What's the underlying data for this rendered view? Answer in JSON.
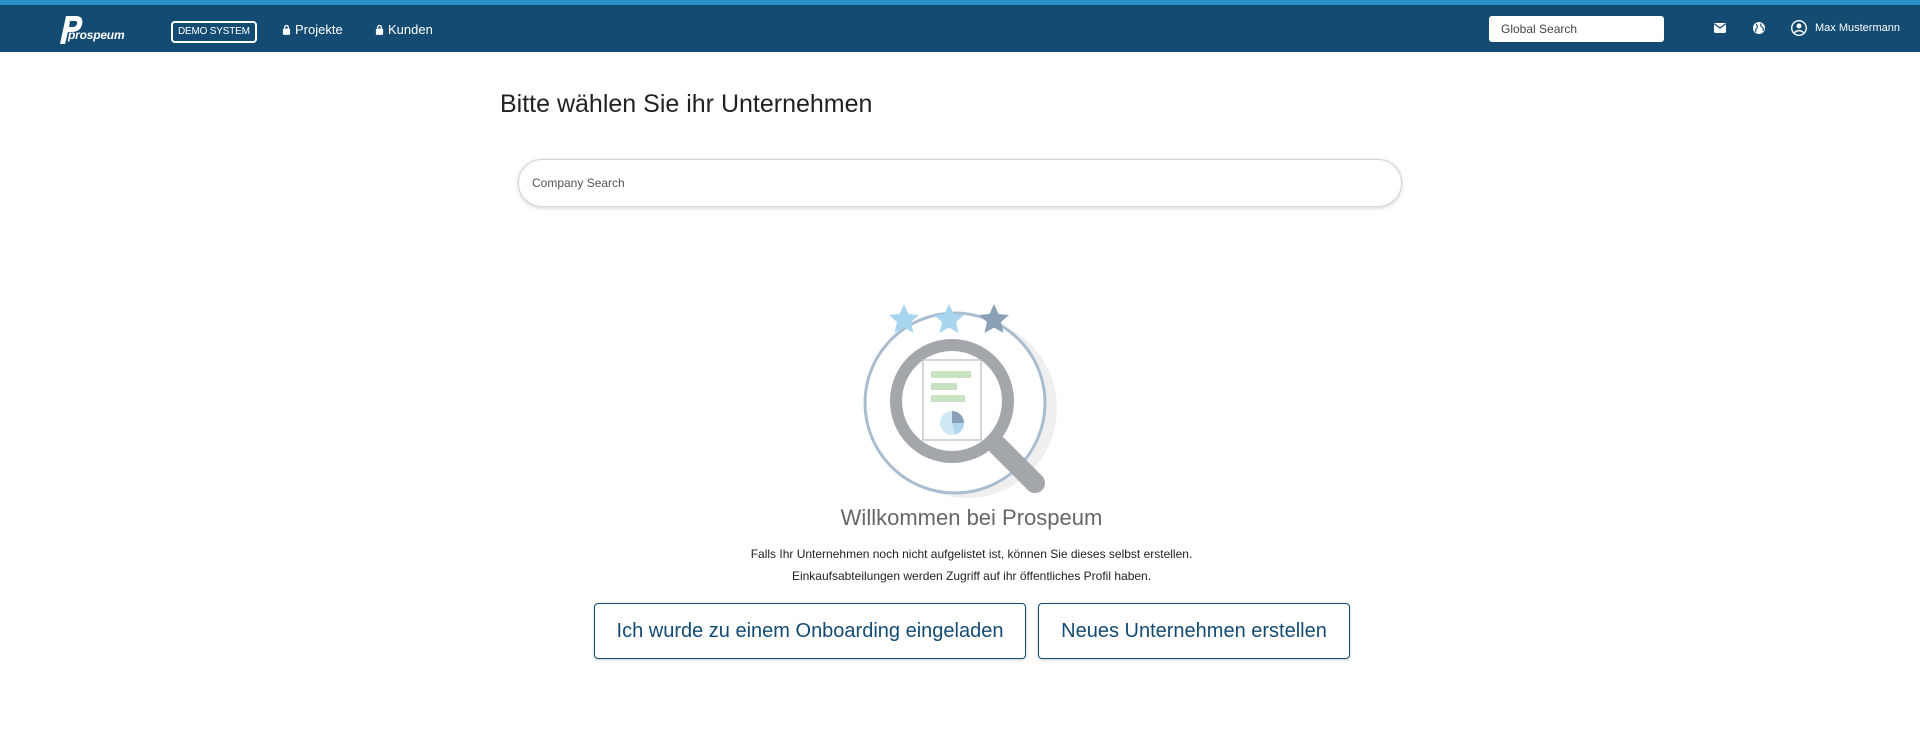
{
  "header": {
    "logo_text": "prospeum",
    "demo_badge": "DEMO SYSTEM",
    "nav": [
      {
        "label": "Projekte",
        "icon": "lock-icon"
      },
      {
        "label": "Kunden",
        "icon": "lock-icon"
      }
    ],
    "global_search_placeholder": "Global Search",
    "user_name": "Max Mustermann"
  },
  "main": {
    "title": "Bitte wählen Sie ihr Unternehmen",
    "company_search_placeholder": "Company Search",
    "welcome": "Willkommen bei Prospeum",
    "info_line_1": "Falls Ihr Unternehmen noch nicht aufgelistet ist, können Sie dieses selbst erstellen.",
    "info_line_2": "Einkaufsabteilungen werden Zugriff auf ihr öffentliches Profil haben.",
    "invite_button": "Ich wurde zu einem Onboarding eingeladen",
    "create_button": "Neues Unternehmen erstellen"
  },
  "colors": {
    "navbar": "#134b73",
    "accent_line": "#2a8fc4",
    "button_text": "#134b73"
  }
}
